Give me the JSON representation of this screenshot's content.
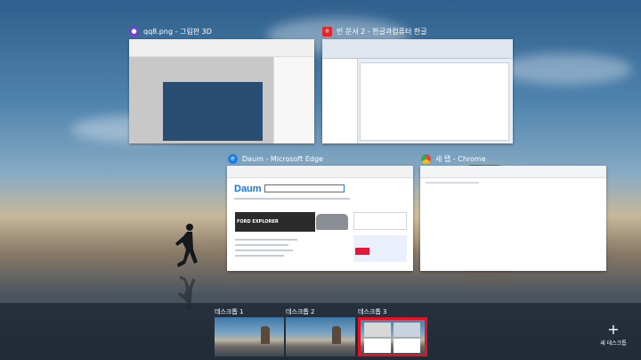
{
  "windows": [
    {
      "id": "paint3d",
      "title": "qq8.png - 그림판 3D",
      "icon": "paint3d-icon",
      "icon_color": "#7a3cd6"
    },
    {
      "id": "hangul",
      "title": "빈 문서 2 - 한글과컴퓨터 한글",
      "icon": "hangul-icon",
      "icon_color": "#e0282e"
    },
    {
      "id": "edge",
      "title": "Daum - Microsoft Edge",
      "icon": "edge-icon",
      "icon_color": "#1f7fe0",
      "content": {
        "logo": "Daum",
        "ad_text": "FORD EXPLORER"
      }
    },
    {
      "id": "chrome",
      "title": "새 탭 - Chrome",
      "icon": "chrome-icon",
      "icon_color": "#34a853"
    }
  ],
  "desktops": [
    {
      "label": "데스크톱 1",
      "selected": false
    },
    {
      "label": "데스크톱 2",
      "selected": false
    },
    {
      "label": "데스크톱 3",
      "selected": true
    }
  ],
  "new_desktop": {
    "icon": "+",
    "label": "새 데스크톱"
  },
  "colors": {
    "selection": "#e81123",
    "strip": "#1e2834"
  }
}
